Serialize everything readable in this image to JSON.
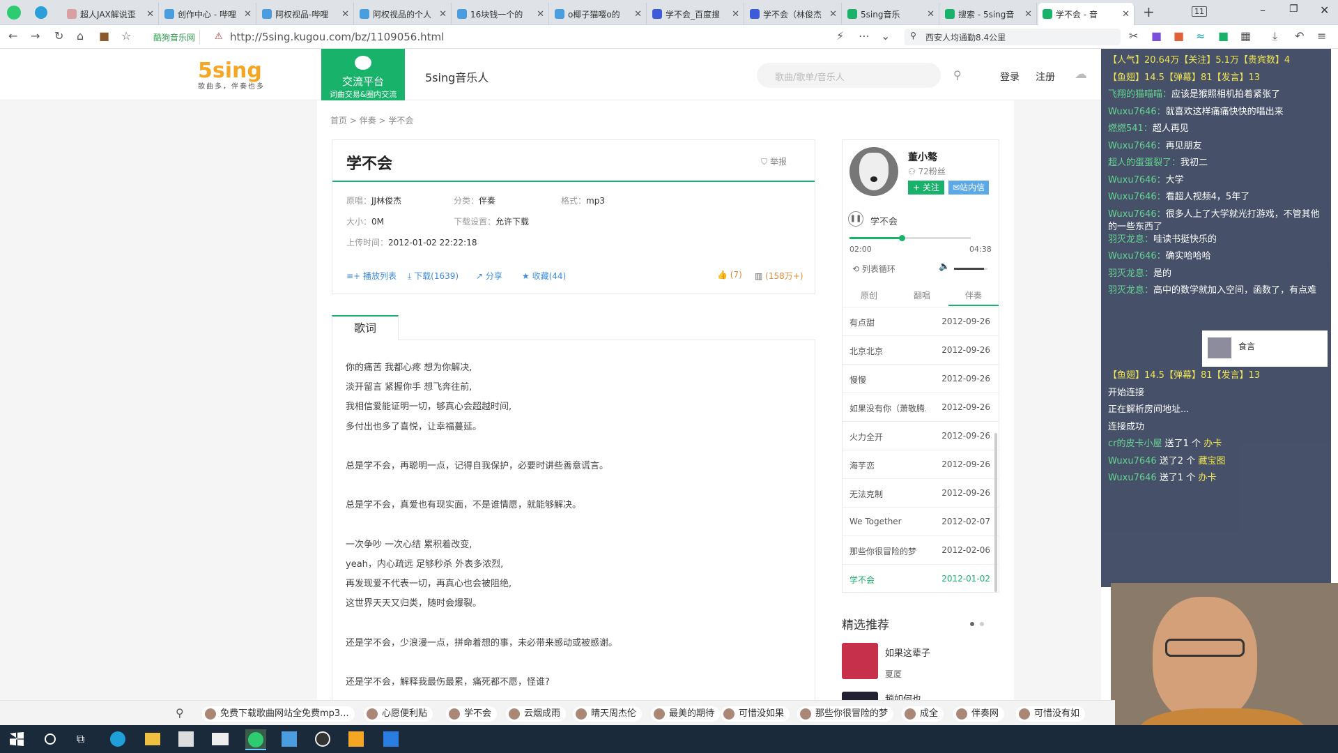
{
  "browser": {
    "tabs": [
      {
        "title": "超人JAX解说歪",
        "color": "#d8a0a0"
      },
      {
        "title": "创作中心 - 哔哩",
        "color": "#4a9ee0"
      },
      {
        "title": "阿权视品-哔哩",
        "color": "#4a9ee0"
      },
      {
        "title": "阿权视品的个人",
        "color": "#4a9ee0"
      },
      {
        "title": "16块钱一个的",
        "color": "#4a9ee0"
      },
      {
        "title": "o椰子猫嘤o的",
        "color": "#4a9ee0"
      },
      {
        "title": "学不会_百度搜",
        "color": "#3b5bdb"
      },
      {
        "title": "学不会（林俊杰",
        "color": "#3b5bdb"
      },
      {
        "title": "5sing音乐",
        "color": "#19b26a"
      },
      {
        "title": "搜索 - 5sing音",
        "color": "#19b26a"
      },
      {
        "title": "学不会 - 音",
        "color": "#19b26a"
      }
    ],
    "new_tab": "+",
    "tab_count": "11",
    "site_pill": "酷狗音乐网",
    "url": "http://5sing.kugou.com/bz/1109056.html",
    "search_text": "西安人均通勤8.4公里"
  },
  "site": {
    "logo": "5sing",
    "logo_slogan": "歌曲多，伴奏也多",
    "exchange_title": "交流平台",
    "exchange_sub": "词曲交易&圈内交流",
    "musician": "5sing音乐人",
    "search_placeholder": "歌曲/歌单/音乐人",
    "login": "登录",
    "register": "注册"
  },
  "breadcrumb": [
    "首页",
    "伴奏",
    "学不会"
  ],
  "song": {
    "title": "学不会",
    "report": "举报",
    "original_label": "原唱：",
    "original": "JJ林俊杰",
    "category_label": "分类：",
    "category": "伴奏",
    "format_label": "格式：",
    "format": "mp3",
    "size_label": "大小：",
    "size": "0M",
    "download_setting_label": "下载设置：",
    "download_setting": "允许下载",
    "upload_label": "上传时间：",
    "upload_time": "2012-01-02 22:22:18",
    "actions": [
      "播放列表",
      "下载(1639)",
      "分享",
      "收藏(44)"
    ],
    "likes": "(7)",
    "plays": "(158万+)"
  },
  "lyrics_tab": "歌词",
  "lyrics": [
    "你的痛苦 我都心疼 想为你解决,",
    "淡开留言 紧握你手 想飞奔往前,",
    "我相信爱能证明一切，够真心会超越时间,",
    "多付出也多了喜悦，让幸福蔓延。",
    "",
    "总是学不会，再聪明一点，记得自我保护，必要时讲些善意谎言。",
    "",
    "总是学不会，真爱也有现实面，不是谁情愿，就能够解决。",
    "",
    "一次争吵 一次心结 累积着改变,",
    "yeah，内心疏远 足够秒杀 外表多浓烈,",
    "再发现爱不代表一切，再真心也会被阻绝,",
    "这世界天天又归类，随时会爆裂。",
    "",
    "还是学不会，少浪漫一点，拼命着想的事，未必带来感动或被感谢。",
    "",
    "还是学不会，解释我最伤最累，痛死都不愿，怪谁?"
  ],
  "user": {
    "name": "董小骜",
    "fans": "72粉丝",
    "follow": "+ 关注",
    "message": "站内信"
  },
  "player": {
    "song": "学不会",
    "current": "02:00",
    "total": "04:38",
    "progress": 0.43,
    "loop": "列表循环",
    "volume": 0.9
  },
  "song_tabs": [
    "原创",
    "翻唱",
    "伴奏"
  ],
  "song_list": [
    {
      "name": "有点甜",
      "date": "2012-09-26"
    },
    {
      "name": "北京北京",
      "date": "2012-09-26"
    },
    {
      "name": "慢慢",
      "date": "2012-09-26"
    },
    {
      "name": "如果没有你（萧敬腾...",
      "date": "2012-09-26"
    },
    {
      "name": "火力全开",
      "date": "2012-09-26"
    },
    {
      "name": "海芋恋",
      "date": "2012-09-26"
    },
    {
      "name": "无法克制",
      "date": "2012-09-26"
    },
    {
      "name": "We Together",
      "date": "2012-02-07"
    },
    {
      "name": "那些你很冒险的梦",
      "date": "2012-02-06"
    },
    {
      "name": "学不会",
      "date": "2012-01-02"
    }
  ],
  "recommend": {
    "title": "精选推荐",
    "items": [
      {
        "name": "如果这辈子",
        "artist": "夏厦"
      },
      {
        "name": "趟如何也",
        "artist": ""
      }
    ]
  },
  "chat": {
    "lines": [
      {
        "type": "stat",
        "text": "【人气】20.64万【关注】5.1万【贵宾数】4"
      },
      {
        "type": "stat",
        "text": "【鱼翅】14.5【弹幕】81【发言】13"
      },
      {
        "type": "msg",
        "user": "飞翔的猫喵喵：",
        "text": "应该是猴照相机拍着紧张了"
      },
      {
        "type": "msg",
        "user": "Wuxu7646：",
        "text": "就喜欢这样痛痛快快的唱出来"
      },
      {
        "type": "msg",
        "user": "燃燃541：",
        "text": "超人再见"
      },
      {
        "type": "msg",
        "user": "Wuxu7646：",
        "text": "再见朋友"
      },
      {
        "type": "msg",
        "user": "超人的蛋蛋裂了：",
        "text": "我初二"
      },
      {
        "type": "msg",
        "user": "Wuxu7646：",
        "text": "大学"
      },
      {
        "type": "msg",
        "user": "Wuxu7646：",
        "text": "看超人视频4，5年了"
      },
      {
        "type": "msg",
        "user": "Wuxu7646：",
        "text": "很多人上了大学就光打游戏，不管其他的一些东西了"
      },
      {
        "type": "msg",
        "user": "羽灭龙息：",
        "text": "哇读书挺快乐的"
      },
      {
        "type": "msg",
        "user": "Wuxu7646：",
        "text": "确实哈哈哈"
      },
      {
        "type": "msg",
        "user": "羽灭龙息：",
        "text": "是的"
      },
      {
        "type": "msg",
        "user": "羽灭龙息：",
        "text": "高中的数学就加入空间，函数了，有点难"
      }
    ],
    "lines2": [
      {
        "type": "stat",
        "text": "【鱼翅】14.5【弹幕】81【发言】13"
      },
      {
        "type": "sys",
        "text": "开始连接"
      },
      {
        "type": "sys",
        "text": "正在解析房间地址..."
      },
      {
        "type": "sys",
        "text": "连接成功"
      },
      {
        "type": "gift",
        "user": "cr的皮卡小屋",
        "text": "送了1 个",
        "gift": "办卡"
      },
      {
        "type": "gift",
        "user": "Wuxu7646",
        "text": "送了2 个",
        "gift": "藏宝图"
      },
      {
        "type": "gift",
        "user": "Wuxu7646",
        "text": "送了1 个",
        "gift": "办卡"
      }
    ],
    "side_name": "食言"
  },
  "bookmarks": [
    "免费下载歌曲网站全免费mp3...",
    "心愿便利贴",
    "学不会",
    "云烟成雨",
    "晴天周杰伦",
    "最美的期待",
    "可惜没如果",
    "那些你很冒险的梦",
    "成全",
    "伴奏网",
    "可惜没有如"
  ]
}
